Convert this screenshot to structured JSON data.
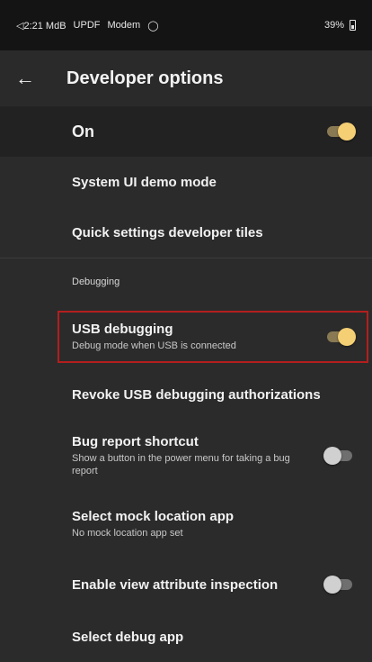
{
  "status_bar": {
    "left_text": "◁2:21 MdB",
    "carrier_1": "UPDF",
    "carrier_2": "Modem",
    "battery_text": "39%"
  },
  "app_bar": {
    "title": "Developer options",
    "back_icon": "arrow-left-icon"
  },
  "master_switch": {
    "label": "On",
    "state": "on"
  },
  "items_top": [
    {
      "title": "System UI demo mode"
    },
    {
      "title": "Quick settings developer tiles"
    }
  ],
  "category": "Debugging",
  "items_debug": [
    {
      "title": "USB debugging",
      "summary": "Debug mode when USB is connected",
      "toggle": "on"
    },
    {
      "title": "Revoke USB debugging authorizations"
    },
    {
      "title": "Bug report shortcut",
      "summary": "Show a button in the power menu for taking a bug report",
      "toggle": "off"
    },
    {
      "title": "Select mock location app",
      "summary": "No mock location app set"
    },
    {
      "title": "Enable view attribute inspection",
      "toggle": "off"
    },
    {
      "title": "Select debug app"
    }
  ],
  "colors": {
    "accent": "#f5cf74",
    "highlight": "#b41e1e",
    "background": "#2b2b2b"
  }
}
